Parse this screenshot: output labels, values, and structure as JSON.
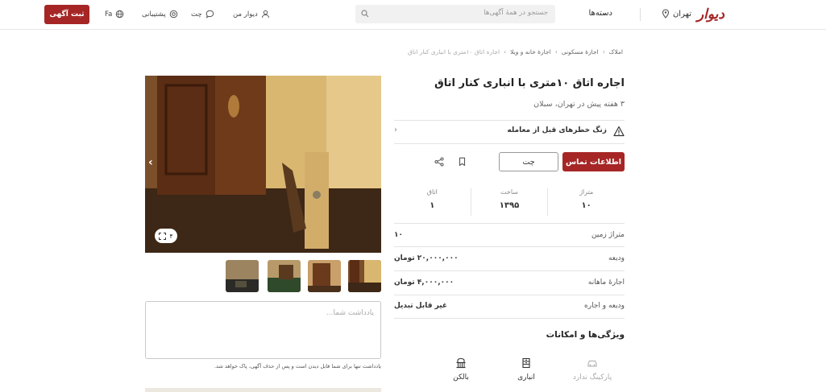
{
  "header": {
    "logo": "دیوار",
    "city": "تهران",
    "categories_label": "دسته‌ها",
    "search_placeholder": "جستجو در همهٔ آگهی‌ها",
    "my_divar": "دیوار من",
    "chat": "چت",
    "support": "پشتیبانی",
    "language": "Fa",
    "post_ad": "ثبت آگهی"
  },
  "breadcrumb": [
    "املاک",
    "اجارهٔ مسکونی",
    "اجارهٔ خانه و ویلا",
    "اجاره اتاق ۱۰متری با انباری کنار اتاق"
  ],
  "ad": {
    "title": "اجاره اتاق ۱۰متری با انباری کنار اتاق",
    "subtitle": "۳ هفته پیش در تهران، سبلان",
    "warning": "زنگ خطرهای قبل از معامله",
    "contact_button": "اطلاعات تماس",
    "chat_button": "چت",
    "specs": [
      {
        "label": "متراژ",
        "value": "۱۰"
      },
      {
        "label": "ساخت",
        "value": "۱۳۹۵"
      },
      {
        "label": "اتاق",
        "value": "۱"
      }
    ],
    "rows": [
      {
        "label": "متراژ زمین",
        "value": "۱۰"
      },
      {
        "label": "ودیعه",
        "value": "۲۰,۰۰۰,۰۰۰ تومان"
      },
      {
        "label": "اجارهٔ ماهانه",
        "value": "۴,۰۰۰,۰۰۰ تومان"
      },
      {
        "label": "ودیعه و اجاره",
        "value": "غیر قابل تبدیل"
      }
    ],
    "features_title": "ویژگی‌ها و امکانات",
    "features": [
      {
        "label": "پارکینگ ندارد",
        "icon": "car-icon",
        "available": false
      },
      {
        "label": "انباری",
        "icon": "storage-icon",
        "available": true
      },
      {
        "label": "بالکن",
        "icon": "balcony-icon",
        "available": true
      }
    ]
  },
  "gallery": {
    "image_count": "۴",
    "thumbnails": 4
  },
  "note": {
    "placeholder": "یادداشت شما...",
    "hint": "یادداشت تنها برای شما قابل دیدن است و پس از حذف آگهی، پاک خواهد شد."
  },
  "colors": {
    "brand": "#a62626",
    "divider": "#e4e4e4"
  }
}
